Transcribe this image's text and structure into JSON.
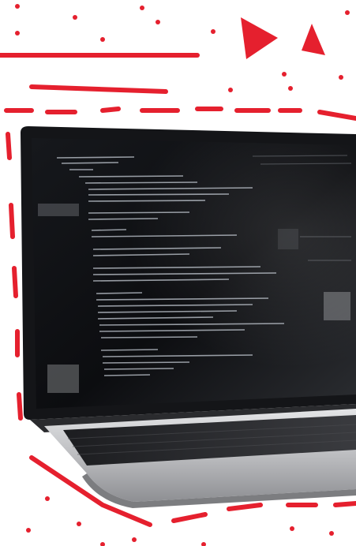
{
  "image": {
    "subject": "laptop-with-code-on-screen",
    "decoration": "hand-drawn-red-dashes-dots-and-arrows"
  },
  "colors": {
    "accent": "#e5202e",
    "background": "#ffffff",
    "screen": "#0f1013",
    "bezel": "#1a1a1c",
    "body_silver": "#c9cacc",
    "keyboard": "#2a2b2e",
    "code_text": "#cfd6df"
  }
}
